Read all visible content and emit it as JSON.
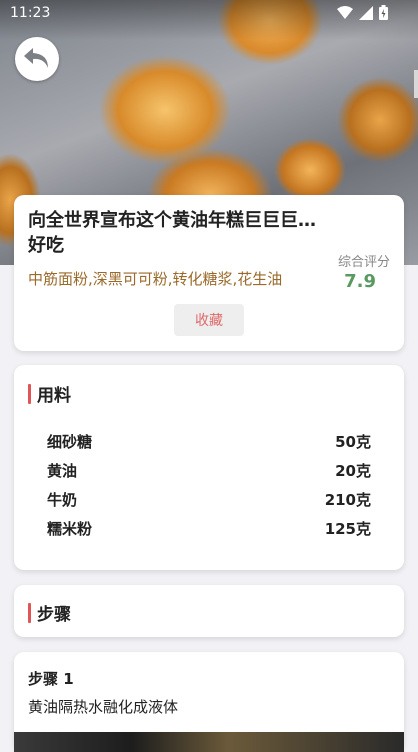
{
  "status_bar": {
    "time": "11:23"
  },
  "hero": {
    "image_icon": "photo-of-baked-cakes"
  },
  "recipe": {
    "title": "向全世界宣布这个黄油年糕巨巨巨… 好吃",
    "ingredients_summary": "中筋面粉,深黑可可粉,转化糖浆,花生油",
    "score_label": "综合评分",
    "score_value": "7.9",
    "favorite_label": "收藏"
  },
  "ingredients_section": {
    "heading": "用料",
    "items": [
      {
        "name": "细砂糖",
        "amount": "50克"
      },
      {
        "name": "黄油",
        "amount": "20克"
      },
      {
        "name": "牛奶",
        "amount": "210克"
      },
      {
        "name": "糯米粉",
        "amount": "125克"
      }
    ]
  },
  "steps_section": {
    "heading": "步骤",
    "steps": [
      {
        "title": "步骤 1",
        "text": "黄油隔热水融化成液体"
      }
    ]
  },
  "colors": {
    "accent_bar": "#e05555",
    "score": "#5a9a62",
    "ingredients_text": "#9a6a2a",
    "favorite_text": "#e06a6a"
  }
}
